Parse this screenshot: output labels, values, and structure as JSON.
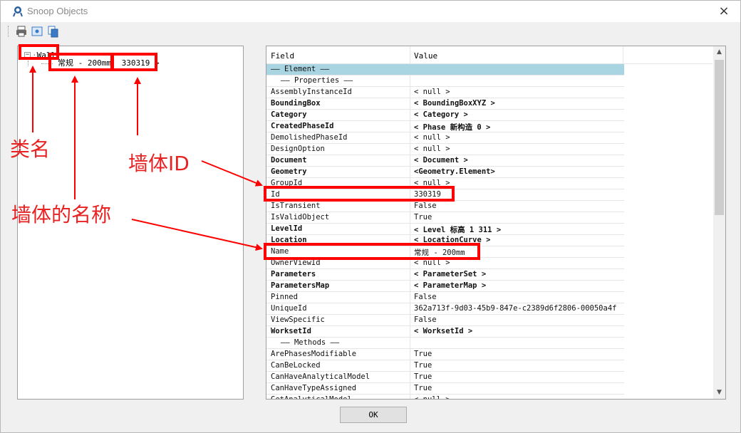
{
  "window": {
    "title": "Snoop Objects",
    "close_glyph": "×"
  },
  "toolbar": {
    "icons": [
      "printer-icon",
      "preview-icon",
      "copy-icon"
    ]
  },
  "tree": {
    "root_toggle": "−",
    "root_label": "Wall",
    "child_name": "常规 - 200mm",
    "child_id": "330319 >"
  },
  "grid": {
    "header": {
      "field": "Field",
      "value": "Value"
    },
    "rows": [
      {
        "field": "—— Element ——",
        "value": "",
        "kind": "section"
      },
      {
        "field": "—— Properties ——",
        "value": "",
        "kind": "sub"
      },
      {
        "field": "AssemblyInstanceId",
        "value": "< null >",
        "kind": "normal"
      },
      {
        "field": "BoundingBox",
        "value": "< BoundingBoxXYZ >",
        "kind": "bold"
      },
      {
        "field": "Category",
        "value": "< Category >",
        "kind": "bold"
      },
      {
        "field": "CreatedPhaseId",
        "value": "< Phase  新构造    0 >",
        "kind": "bold"
      },
      {
        "field": "DemolishedPhaseId",
        "value": "< null >",
        "kind": "normal"
      },
      {
        "field": "DesignOption",
        "value": "< null >",
        "kind": "normal"
      },
      {
        "field": "Document",
        "value": "< Document >",
        "kind": "bold"
      },
      {
        "field": "Geometry",
        "value": "<Geometry.Element>",
        "kind": "bold"
      },
      {
        "field": "GroupId",
        "value": "< null >",
        "kind": "normal"
      },
      {
        "field": "Id",
        "value": "330319",
        "kind": "normal"
      },
      {
        "field": "IsTransient",
        "value": "False",
        "kind": "normal"
      },
      {
        "field": "IsValidObject",
        "value": "True",
        "kind": "normal"
      },
      {
        "field": "LevelId",
        "value": "< Level  标高 1   311 >",
        "kind": "bold"
      },
      {
        "field": "Location",
        "value": "< LocationCurve >",
        "kind": "bold"
      },
      {
        "field": "Name",
        "value": "常规 - 200mm",
        "kind": "normal"
      },
      {
        "field": "OwnerViewId",
        "value": "< null >",
        "kind": "normal"
      },
      {
        "field": "Parameters",
        "value": "< ParameterSet >",
        "kind": "bold"
      },
      {
        "field": "ParametersMap",
        "value": "< ParameterMap >",
        "kind": "bold"
      },
      {
        "field": "Pinned",
        "value": "False",
        "kind": "normal"
      },
      {
        "field": "UniqueId",
        "value": "362a713f-9d03-45b9-847e-c2389d6f2806-00050a4f",
        "kind": "normal"
      },
      {
        "field": "ViewSpecific",
        "value": "False",
        "kind": "normal"
      },
      {
        "field": "WorksetId",
        "value": "< WorksetId >",
        "kind": "bold"
      },
      {
        "field": "—— Methods ——",
        "value": "",
        "kind": "sub"
      },
      {
        "field": "ArePhasesModifiable",
        "value": "True",
        "kind": "normal"
      },
      {
        "field": "CanBeLocked",
        "value": "True",
        "kind": "normal"
      },
      {
        "field": "CanHaveAnalyticalModel",
        "value": "True",
        "kind": "normal"
      },
      {
        "field": "CanHaveTypeAssigned",
        "value": "True",
        "kind": "normal"
      },
      {
        "field": "GetAnalyticalModel",
        "value": "< null >",
        "kind": "normal"
      }
    ]
  },
  "buttons": {
    "ok": "OK"
  },
  "scrollbar": {
    "up": "▲",
    "down": "▼"
  },
  "annotations": {
    "class_name": "类名",
    "wall_id": "墙体ID",
    "wall_name": "墙体的名称"
  },
  "colors": {
    "annotation_red": "#ff0000",
    "section_blue": "#a9d5e3"
  }
}
